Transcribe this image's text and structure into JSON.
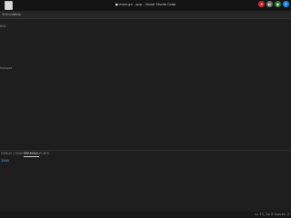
{
  "window": {
    "title": "● main.go - app - Visual Studio Code"
  },
  "tray": {
    "icons": [
      {
        "name": "speaker-off-icon",
        "color": "#c62828",
        "glyph": "✕"
      },
      {
        "name": "mask-icon",
        "color": "#6d6d6d",
        "glyph": "◐"
      },
      {
        "name": "network-icon",
        "color": "#2e7d32",
        "glyph": "◉"
      },
      {
        "name": "bluetooth-icon",
        "color": "#1e88e5",
        "glyph": "ᛒ"
      }
    ]
  },
  "menubar": {
    "items": [
      "Terminal",
      "Help"
    ]
  },
  "editor": {
    "lines": [
      {
        "text": "BSE"
      },
      {
        "text": "hotspot"
      }
    ]
  },
  "panel": {
    "tabs": [
      {
        "label": "DEBUG CONSOLE",
        "active": false
      },
      {
        "label": "TERMINAL",
        "active": true
      },
      {
        "label": "PORTS",
        "active": false
      }
    ],
    "terminal_text": "3300"
  },
  "statusbar": {
    "text": "Ln 53, Col 8   Spaces: 4"
  }
}
